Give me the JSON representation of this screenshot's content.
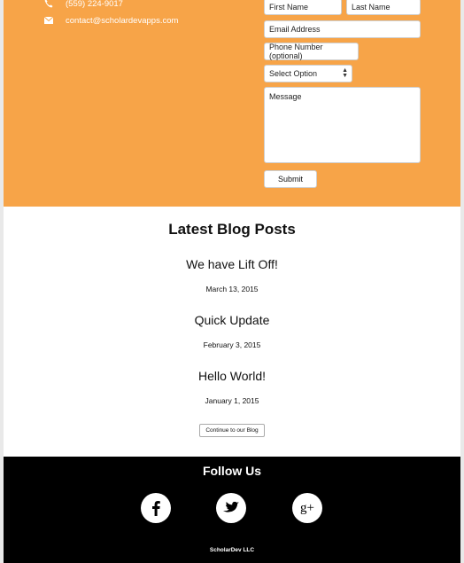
{
  "contact": {
    "phone": "(559) 224-9017",
    "email": "contact@scholardevapps.com",
    "form": {
      "first_name_placeholder": "First Name",
      "last_name_placeholder": "Last Name",
      "email_placeholder": "Email Address",
      "phone_placeholder": "Phone Number (optional)",
      "select_value": "Select Option",
      "message_placeholder": "Message",
      "submit_label": "Submit"
    },
    "background_color": "#f7a448"
  },
  "blog": {
    "heading": "Latest Blog Posts",
    "posts": [
      {
        "title": "We have Lift Off!",
        "date": "March 13, 2015"
      },
      {
        "title": "Quick Update",
        "date": "February 3, 2015"
      },
      {
        "title": "Hello World!",
        "date": "January 1, 2015"
      }
    ],
    "continue_label": "Continue to our Blog"
  },
  "footer": {
    "heading": "Follow Us",
    "social": [
      {
        "icon": "facebook-icon"
      },
      {
        "icon": "twitter-icon"
      },
      {
        "icon": "google-plus-icon"
      }
    ],
    "copyright": "ScholarDev LLC"
  }
}
